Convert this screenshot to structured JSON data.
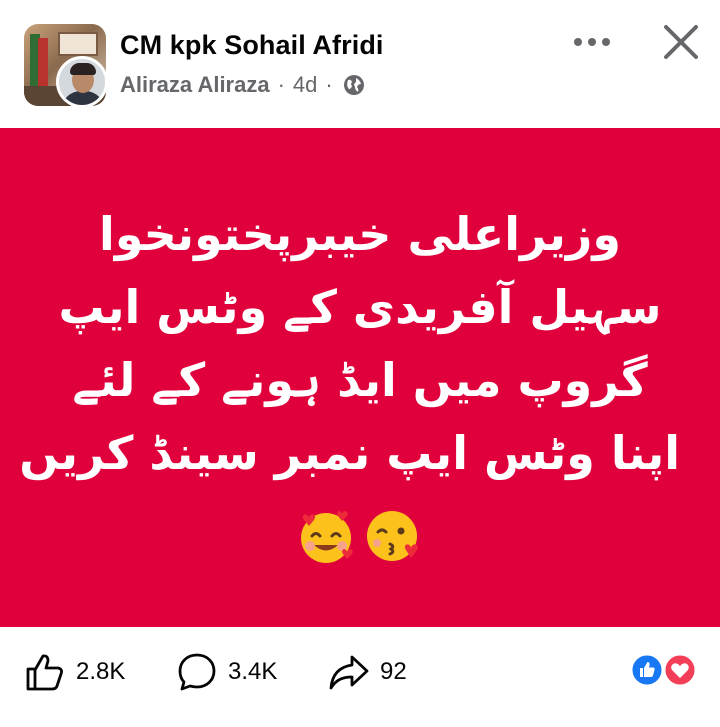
{
  "post": {
    "page_name": "CM kpk Sohail Afridi",
    "author": "Aliraza Aliraza",
    "separator": "·",
    "time": "4d",
    "privacy_icon": "globe-icon",
    "menu_icon": "more-horizontal-icon",
    "close_icon": "close-icon",
    "background_color": "#e0003c",
    "text_lines": [
      "وزیراعلی خیبرپختونخوا",
      "سہیل آفریدی کے وٹس ایپ",
      "گروپ میں ایڈ ہونے کے لئے",
      "اپنا وٹس ایپ نمبر سینڈ کریں"
    ],
    "emojis": [
      "smiling-face-with-hearts-emoji",
      "face-blowing-kiss-emoji"
    ]
  },
  "footer": {
    "likes": "2.8K",
    "comments": "3.4K",
    "shares": "92",
    "like_icon": "thumbs-up-icon",
    "comment_icon": "comment-bubble-icon",
    "share_icon": "share-arrow-icon",
    "reactions": [
      "like-reaction-icon",
      "love-reaction-icon"
    ],
    "colors": {
      "like_blue": "#1877f2",
      "love_red": "#f33e58"
    }
  }
}
